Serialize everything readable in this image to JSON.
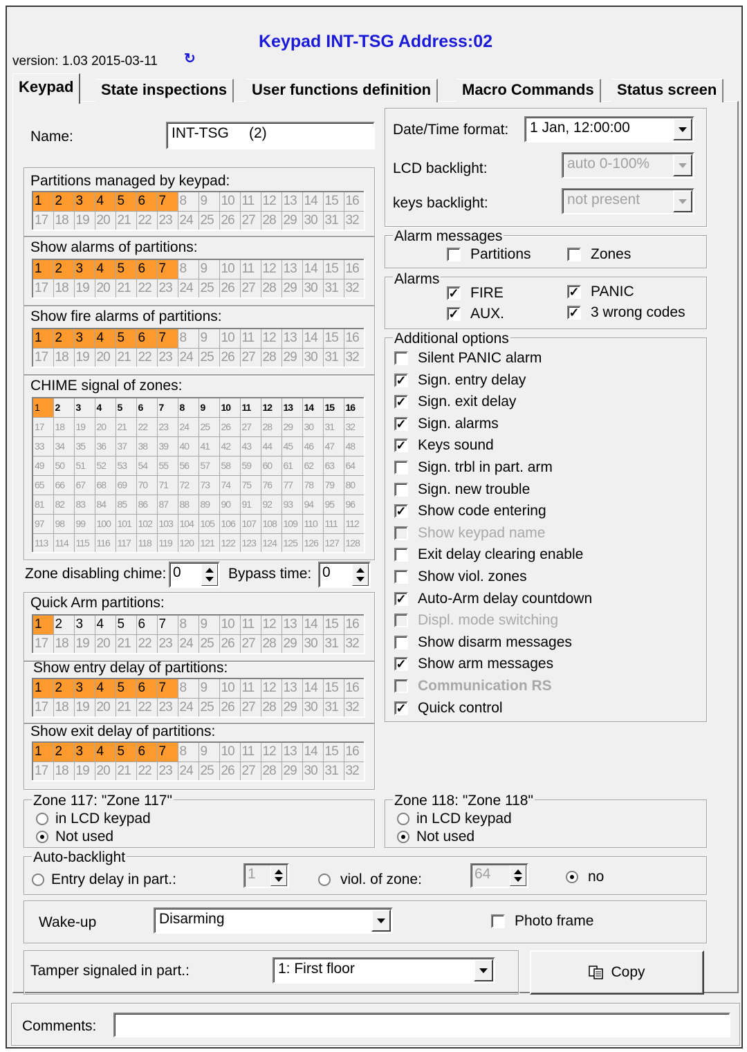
{
  "header": {
    "title": "Keypad INT-TSG Address:02",
    "version": "version: 1.03 2015-03-11",
    "refresh_glyph": "↻"
  },
  "tabs": [
    "Keypad",
    "State inspections",
    "User functions definition",
    "Macro Commands",
    "Status screen"
  ],
  "name": {
    "label": "Name:",
    "value": "INT-TSG     (2)"
  },
  "partitions_managed": {
    "label": "Partitions managed by keypad:",
    "selected": [
      1,
      2,
      3,
      4,
      5,
      6,
      7
    ]
  },
  "show_alarms": {
    "label": "Show alarms of partitions:",
    "selected": [
      1,
      2,
      3,
      4,
      5,
      6,
      7
    ]
  },
  "show_fire_alarms": {
    "label": "Show fire alarms of partitions:",
    "selected": [
      1,
      2,
      3,
      4,
      5,
      6,
      7
    ]
  },
  "chime": {
    "label": "CHIME signal of zones:",
    "selected": [
      1
    ],
    "enabled_max": 16
  },
  "zone_disabling_chime": {
    "label": "Zone disabling chime:",
    "value": "0"
  },
  "bypass_time": {
    "label": "Bypass time:",
    "value": "0"
  },
  "quick_arm": {
    "label": "Quick Arm partitions:",
    "selected": [
      1
    ]
  },
  "entry_delay": {
    "label": "Show entry delay of partitions:",
    "selected": [
      1,
      2,
      3,
      4,
      5,
      6,
      7
    ]
  },
  "exit_delay": {
    "label": "Show exit delay of partitions:",
    "selected": [
      1,
      2,
      3,
      4,
      5,
      6,
      7
    ]
  },
  "date_time_format": {
    "label": "Date/Time format:",
    "value": "1 Jan, 12:00:00"
  },
  "lcd_backlight": {
    "label": "LCD backlight:",
    "value": "auto 0-100%"
  },
  "keys_backlight": {
    "label": "keys backlight:",
    "value": "not present"
  },
  "alarm_messages": {
    "legend": "Alarm messages",
    "partitions": "Partitions",
    "zones": "Zones"
  },
  "alarms": {
    "legend": "Alarms",
    "fire": "FIRE",
    "panic": "PANIC",
    "aux": "AUX.",
    "wrong_codes": "3 wrong codes"
  },
  "additional_options": {
    "legend": "Additional options",
    "items": [
      {
        "label": "Silent PANIC alarm",
        "checked": false,
        "disabled": false
      },
      {
        "label": "Sign. entry delay",
        "checked": true,
        "disabled": false
      },
      {
        "label": "Sign. exit delay",
        "checked": true,
        "disabled": false
      },
      {
        "label": "Sign. alarms",
        "checked": true,
        "disabled": false
      },
      {
        "label": "Keys sound",
        "checked": true,
        "disabled": false
      },
      {
        "label": "Sign. trbl in part. arm",
        "checked": false,
        "disabled": false
      },
      {
        "label": "Sign. new trouble",
        "checked": false,
        "disabled": false
      },
      {
        "label": "Show code entering",
        "checked": true,
        "disabled": false
      },
      {
        "label": "Show keypad name",
        "checked": false,
        "disabled": true
      },
      {
        "label": "Exit delay clearing enable",
        "checked": false,
        "disabled": false
      },
      {
        "label": "Show viol. zones",
        "checked": false,
        "disabled": false
      },
      {
        "label": "Auto-Arm delay countdown",
        "checked": true,
        "disabled": false
      },
      {
        "label": "Displ. mode switching",
        "checked": false,
        "disabled": true
      },
      {
        "label": "Show disarm messages",
        "checked": false,
        "disabled": false
      },
      {
        "label": "Show arm messages",
        "checked": true,
        "disabled": false
      },
      {
        "label": "Communication RS",
        "checked": false,
        "disabled": true
      },
      {
        "label": "Quick control",
        "checked": true,
        "disabled": false
      }
    ]
  },
  "zone117": {
    "legend": "Zone 117: \"Zone 117\"",
    "opt1": "in LCD keypad",
    "opt2": "Not used"
  },
  "zone118": {
    "legend": "Zone 118: \"Zone 118\"",
    "opt1": "in LCD keypad",
    "opt2": "Not used"
  },
  "auto_backlight": {
    "legend": "Auto-backlight",
    "entry_delay_label": "Entry delay in part.:",
    "entry_delay_value": "1",
    "viol_label": "viol. of zone:",
    "viol_value": "64",
    "no_label": "no"
  },
  "wake_up": {
    "label": "Wake-up",
    "value": "Disarming",
    "photo_frame": "Photo frame"
  },
  "tamper": {
    "label": "Tamper signaled in part.:",
    "value": "1: First floor"
  },
  "copy_button": {
    "label": "Copy"
  },
  "comments": {
    "label": "Comments:",
    "value": ""
  }
}
